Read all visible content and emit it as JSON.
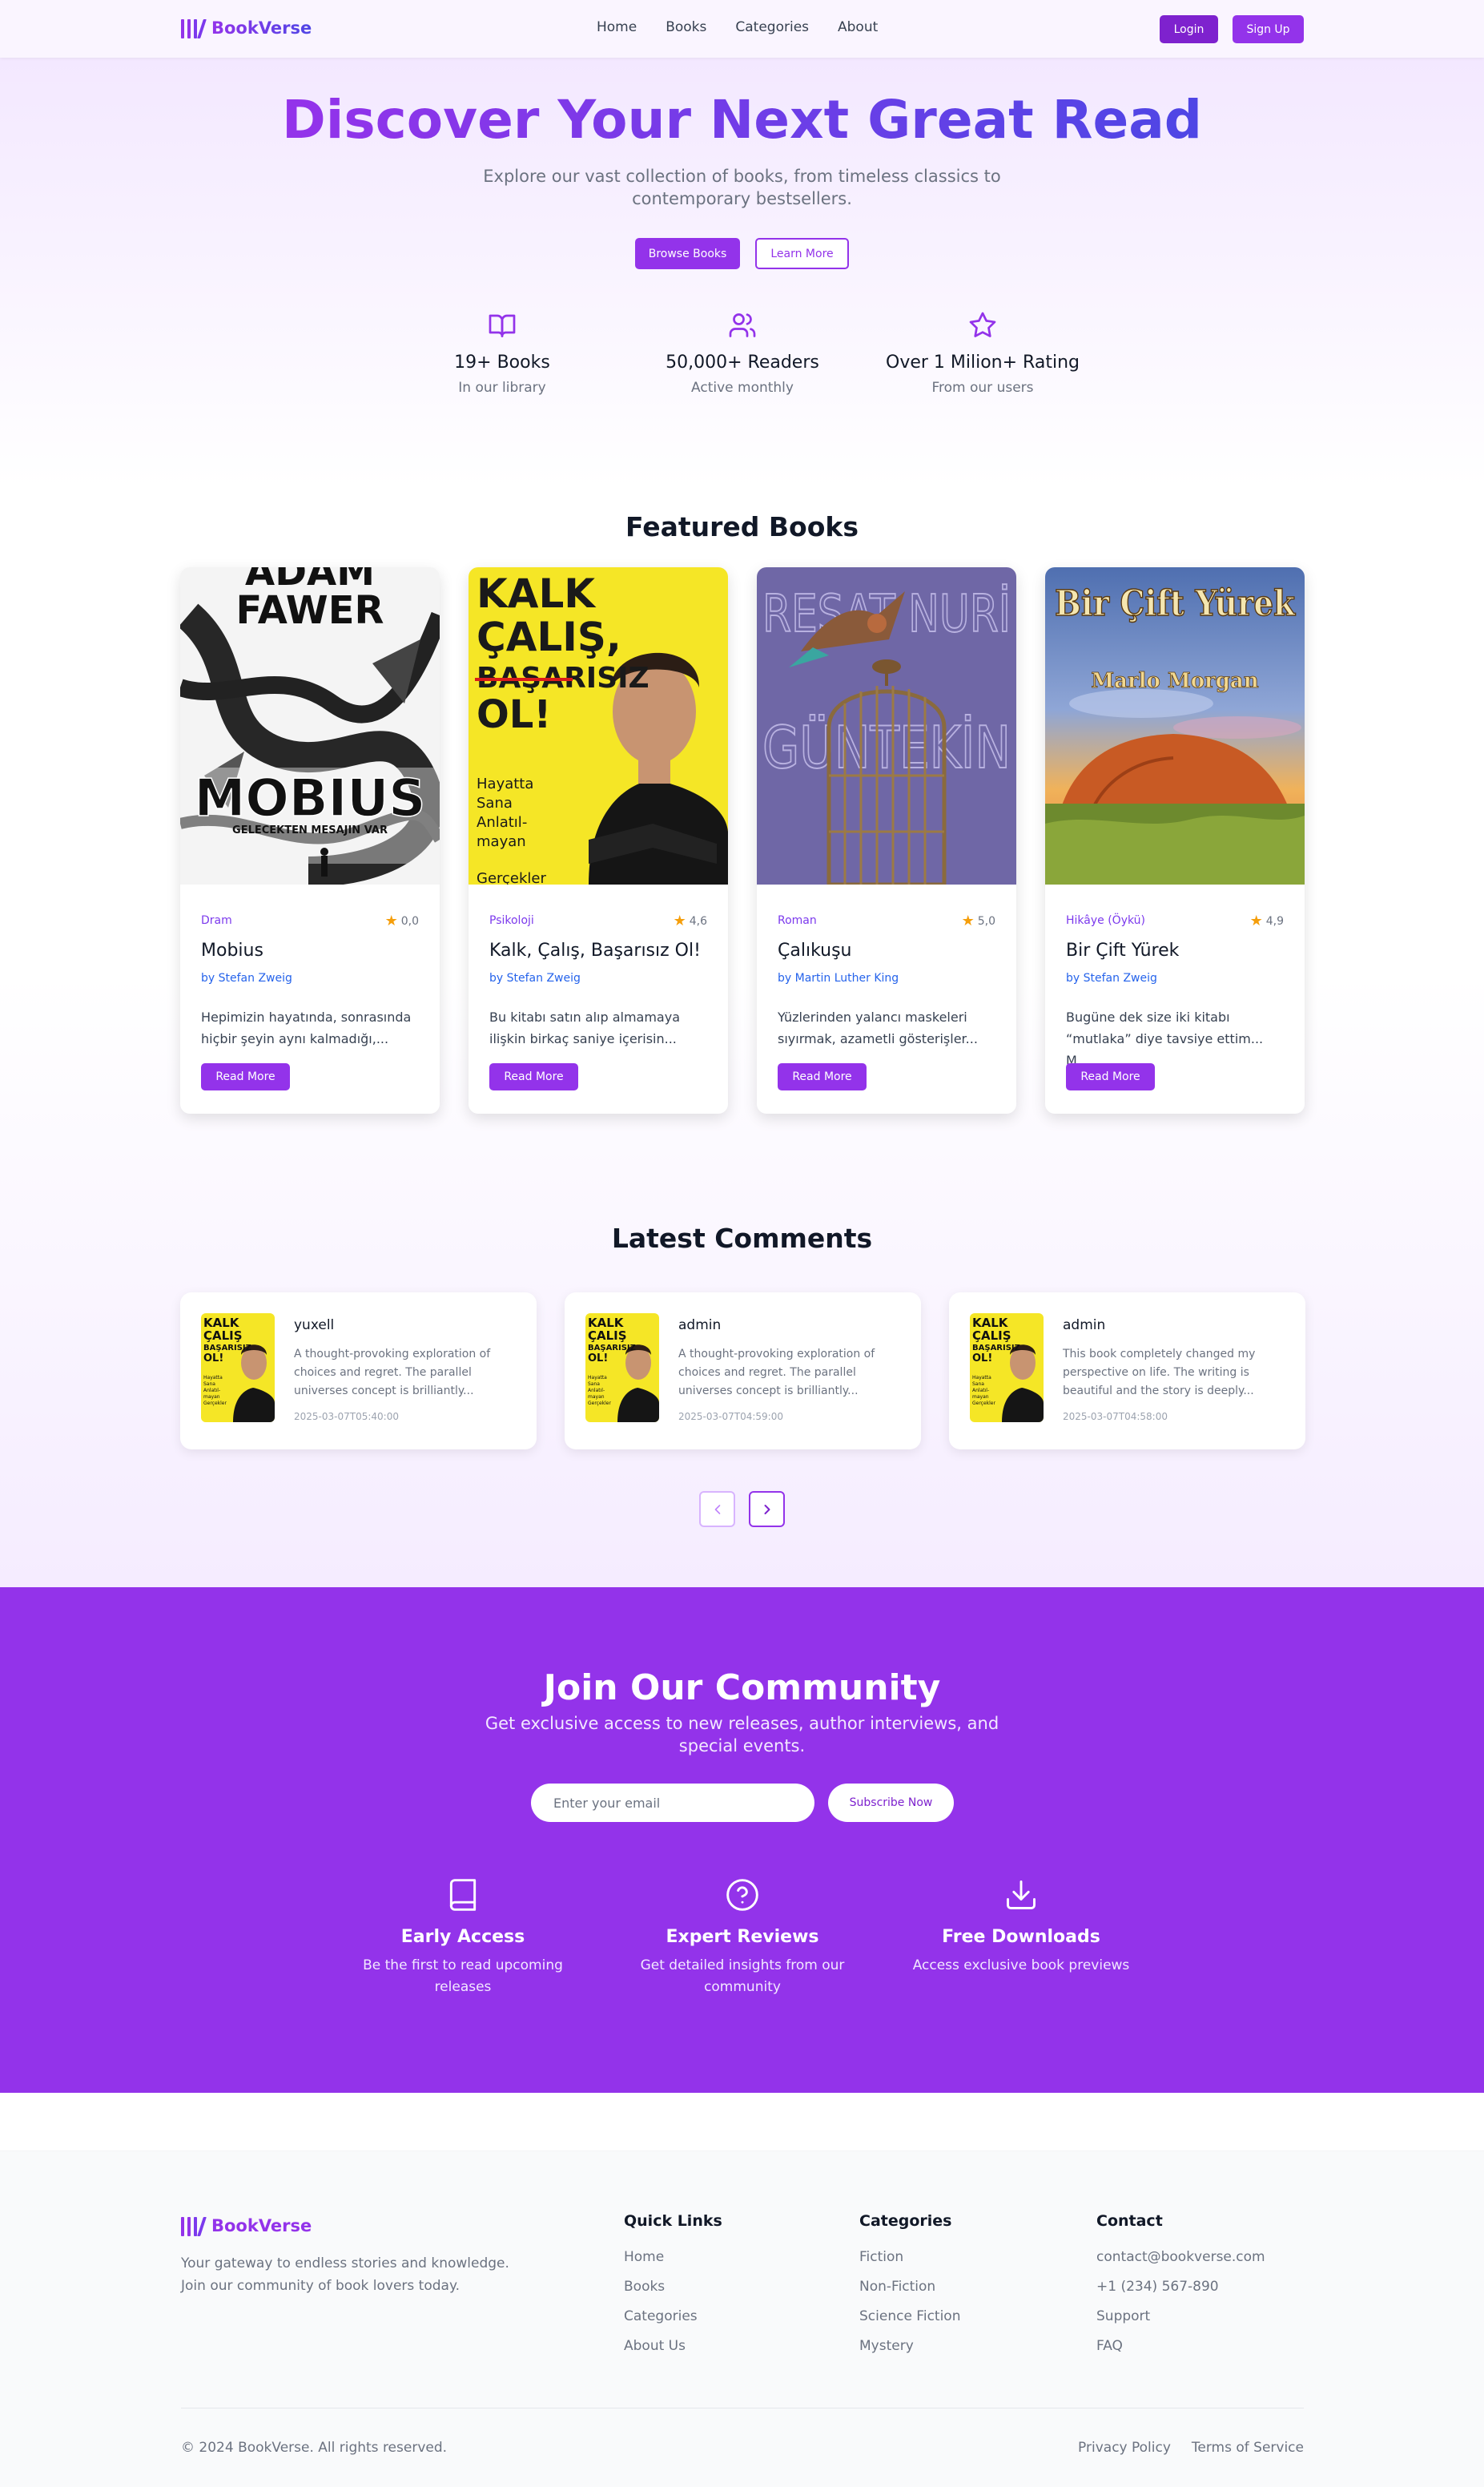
{
  "brand": {
    "name": "BookVerse",
    "accent": "#9333ea",
    "accent_dark": "#7e22ce",
    "indigo": "#4f46e5"
  },
  "nav": {
    "links": [
      "Home",
      "Books",
      "Categories",
      "About"
    ],
    "login_label": "Login",
    "signup_label": "Sign Up"
  },
  "hero": {
    "title": "Discover Your Next Great Read",
    "subtitle": "Explore our vast collection of books, from timeless classics to contemporary bestsellers.",
    "browse_label": "Browse Books",
    "learn_label": "Learn More",
    "stats": [
      {
        "icon": "open-book-icon",
        "value": "19+ Books",
        "label": "In our library"
      },
      {
        "icon": "users-icon",
        "value": "50,000+ Readers",
        "label": "Active monthly"
      },
      {
        "icon": "star-icon",
        "value": "Over 1 Milion+ Rating",
        "label": "From our users"
      }
    ]
  },
  "featured": {
    "title": "Featured Books",
    "read_more_label": "Read More",
    "books": [
      {
        "category": "Dram",
        "rating": "0,0",
        "title": "Mobius",
        "author": "by Stefan Zweig",
        "description": "Hepimizin hayatında, sonrasında hiçbir şeyin aynı kalmadığı,...",
        "cover_text": [
          "ADAM",
          "FAWER",
          "MOBIUS",
          "GELECEKTEN MESAJIN VAR"
        ]
      },
      {
        "category": "Psikoloji",
        "rating": "4,6",
        "title": "Kalk, Çalış, Başarısız Ol!",
        "author": "by Stefan Zweig",
        "description": "Bu kitabı satın alıp almamaya ilişkin birkaç saniye içerisin...",
        "cover_text": [
          "KALK",
          "ÇALIŞ,",
          "BAŞARISIZ",
          "OL!",
          "Hayatta",
          "Sana",
          "Anlatıl-",
          "mayan",
          "Gerçekler"
        ]
      },
      {
        "category": "Roman",
        "rating": "5,0",
        "title": "Çalıkuşu",
        "author": "by Martin Luther King",
        "description": "Yüzlerinden yalancı maskeleri sıyırmak, azametli gösterişler...",
        "cover_text": [
          "REŞAT NURİ",
          "GÜNTEKİN"
        ]
      },
      {
        "category": "Hikâye (Öykü)",
        "rating": "4,9",
        "title": "Bir Çift Yürek",
        "author": "by Stefan Zweig",
        "description": "Bugüne dek size iki kitabı “mutlaka” diye tavsiye ettim... M...",
        "cover_text": [
          "Bir Çift Yürek",
          "Marlo Morgan"
        ]
      }
    ]
  },
  "comments": {
    "title": "Latest Comments",
    "thumb_text": [
      "KALK",
      "ÇALIŞ",
      "BAŞARISIZ",
      "OL!",
      "Hayatta",
      "Sana",
      "Anlatıl-",
      "mayan",
      "Gerçekler"
    ],
    "items": [
      {
        "user": "yuxell",
        "text": "A thought-provoking exploration of choices and regret. The parallel universes concept is brilliantly...",
        "date": "2025-03-07T05:40:00"
      },
      {
        "user": "admin",
        "text": "A thought-provoking exploration of choices and regret. The parallel universes concept is brilliantly...",
        "date": "2025-03-07T04:59:00"
      },
      {
        "user": "admin",
        "text": "This book completely changed my perspective on life. The writing is beautiful and the story is deeply...",
        "date": "2025-03-07T04:58:00"
      }
    ],
    "prev_icon": "chevron-left-icon",
    "next_icon": "chevron-right-icon"
  },
  "community": {
    "title": "Join Our Community",
    "subtitle": "Get exclusive access to new releases, author interviews, and special events.",
    "email_placeholder": "Enter your email",
    "subscribe_label": "Subscribe Now",
    "features": [
      {
        "icon": "book-icon",
        "title": "Early Access",
        "desc": "Be the first to read upcoming releases"
      },
      {
        "icon": "help-circle-icon",
        "title": "Expert Reviews",
        "desc": "Get detailed insights from our community"
      },
      {
        "icon": "download-icon",
        "title": "Free Downloads",
        "desc": "Access exclusive book previews"
      }
    ]
  },
  "footer": {
    "brand": "BookVerse",
    "tagline": "Your gateway to endless stories and knowledge. Join our community of book lovers today.",
    "quick_links": {
      "title": "Quick Links",
      "items": [
        "Home",
        "Books",
        "Categories",
        "About Us"
      ]
    },
    "categories": {
      "title": "Categories",
      "items": [
        "Fiction",
        "Non-Fiction",
        "Science Fiction",
        "Mystery"
      ]
    },
    "contact": {
      "title": "Contact",
      "items": [
        "contact@bookverse.com",
        "+1 (234) 567-890",
        "Support",
        "FAQ"
      ]
    },
    "copyright": "© 2024 BookVerse. All rights reserved.",
    "privacy": "Privacy Policy",
    "terms": "Terms of Service"
  }
}
